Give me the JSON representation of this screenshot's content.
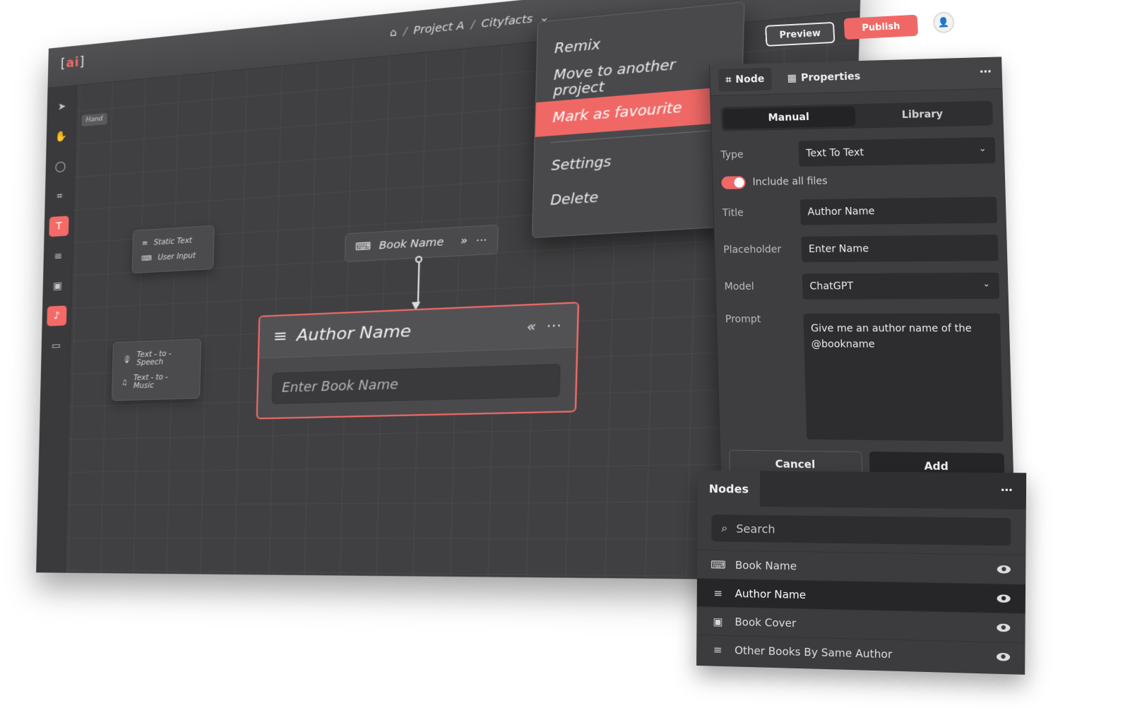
{
  "app": {
    "logo_bracket_open": "[",
    "logo_text": "ai",
    "logo_bracket_close": "]"
  },
  "breadcrumb": {
    "project": "Project A",
    "page": "Cityfacts",
    "separator": "/"
  },
  "header": {
    "preview_label": "Preview",
    "publish_label": "Publish"
  },
  "toolbar": {
    "hand_tooltip": "Hand"
  },
  "flyouts": {
    "text": {
      "static_text": "Static Text",
      "user_input": "User Input"
    },
    "audio": {
      "text_to_speech": "Text - to - Speech",
      "text_to_music": "Text - to - Music"
    }
  },
  "canvas": {
    "book_node": {
      "label": "Book Name"
    },
    "author_node": {
      "title": "Author Name",
      "placeholder": "Enter Book Name"
    }
  },
  "context_menu": {
    "items": [
      {
        "label": "Remix"
      },
      {
        "label": "Move to another project"
      },
      {
        "label": "Mark as favourite"
      },
      {
        "label": "Settings"
      },
      {
        "label": "Delete"
      }
    ]
  },
  "properties": {
    "tabs": [
      {
        "label": "Node"
      },
      {
        "label": "Properties"
      }
    ],
    "modes": [
      {
        "label": "Manual"
      },
      {
        "label": "Library"
      }
    ],
    "type": {
      "label": "Type",
      "value": "Text To Text"
    },
    "include_all_files": {
      "label": "Include all files",
      "on": true
    },
    "title": {
      "label": "Title",
      "value": "Author Name"
    },
    "placeholder": {
      "label": "Placeholder",
      "value": "Enter Name"
    },
    "model": {
      "label": "Model",
      "value": "ChatGPT"
    },
    "prompt": {
      "label": "Prompt",
      "value": "Give me an author name of the @bookname"
    },
    "cancel_label": "Cancel",
    "add_label": "Add"
  },
  "nodes_panel": {
    "title": "Nodes",
    "search_placeholder": "Search",
    "items": [
      {
        "label": "Book Name"
      },
      {
        "label": "Author Name"
      },
      {
        "label": "Book Cover"
      },
      {
        "label": "Other Books By Same Author"
      }
    ]
  },
  "colors": {
    "accent": "#f06865",
    "panel": "#3e3e41",
    "canvas": "#404042"
  }
}
